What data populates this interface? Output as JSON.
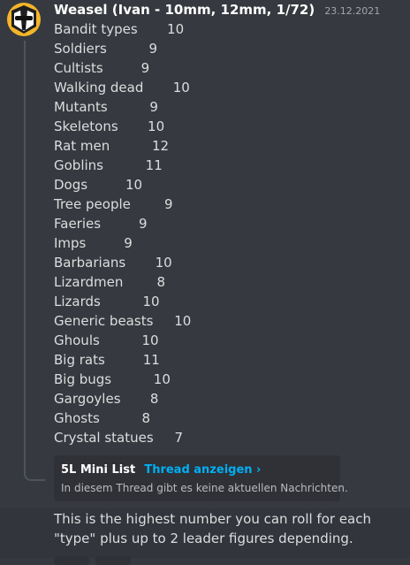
{
  "message": {
    "username": "Weasel (Ivan - 10mm, 12mm, 1/72)",
    "timestamp": "23.12.2021",
    "lines": [
      "Bandit types       10",
      "Soldiers          9",
      "Cultists         9",
      "Walking dead       10",
      "Mutants          9",
      "Skeletons       10",
      "Rat men          12",
      "Goblins          11",
      "Dogs         10",
      "Tree people        9",
      "Faeries         9",
      "Imps         9",
      "Barbarians       10",
      "Lizardmen        8",
      "Lizards          10",
      "Generic beasts     10",
      "Ghouls          10",
      "Big rats         11",
      "Big bugs          10",
      "Gargoyles       8",
      "Ghosts          8",
      "Crystal statues     7"
    ]
  },
  "thread": {
    "name": "5L Mini List",
    "link": "Thread anzeigen ›",
    "subtitle": "In diesem Thread gibt es keine aktuellen Nachrichten."
  },
  "message2": {
    "text": "This is the highest number you can roll for each \"type\" plus up to 2 leader figures depending."
  },
  "colors": {
    "background": "#36393f",
    "link": "#00aff4",
    "avatar": "#f4b52a"
  }
}
